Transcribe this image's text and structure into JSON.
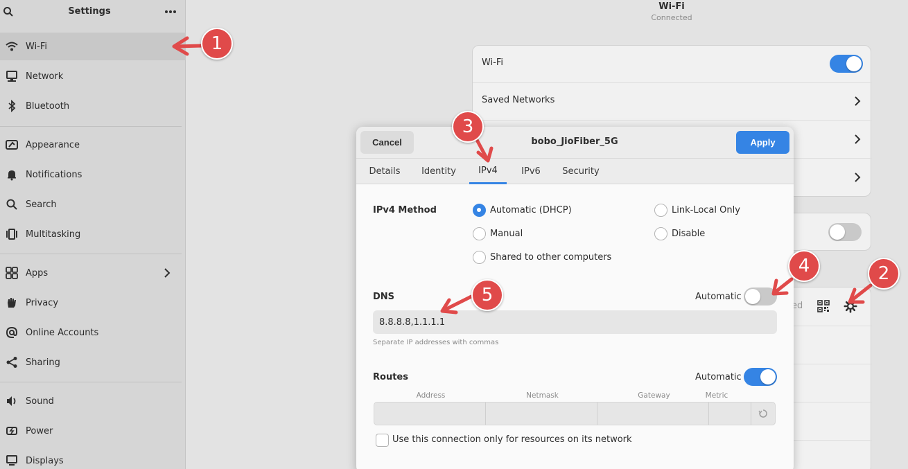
{
  "sidebar": {
    "title": "Settings",
    "items": [
      {
        "label": "Wi-Fi",
        "icon": "wifi-icon"
      },
      {
        "label": "Network",
        "icon": "network-icon"
      },
      {
        "label": "Bluetooth",
        "icon": "bluetooth-icon"
      },
      {
        "label": "Appearance",
        "icon": "appearance-icon"
      },
      {
        "label": "Notifications",
        "icon": "bell-icon"
      },
      {
        "label": "Search",
        "icon": "search-icon"
      },
      {
        "label": "Multitasking",
        "icon": "multitasking-icon"
      },
      {
        "label": "Apps",
        "icon": "apps-icon"
      },
      {
        "label": "Privacy",
        "icon": "hand-icon"
      },
      {
        "label": "Online Accounts",
        "icon": "at-icon"
      },
      {
        "label": "Sharing",
        "icon": "share-icon"
      },
      {
        "label": "Sound",
        "icon": "speaker-icon"
      },
      {
        "label": "Power",
        "icon": "power-icon"
      },
      {
        "label": "Displays",
        "icon": "display-icon"
      }
    ]
  },
  "main": {
    "title": "Wi-Fi",
    "subtitle": "Connected",
    "wifi_label": "Wi-Fi",
    "wifi_enabled": true,
    "saved_networks_label": "Saved Networks",
    "partial_text": "ed"
  },
  "dialog": {
    "cancel_label": "Cancel",
    "title": "bobo_JioFiber_5G",
    "apply_label": "Apply",
    "tabs": [
      "Details",
      "Identity",
      "IPv4",
      "IPv6",
      "Security"
    ],
    "active_tab": "IPv4",
    "ipv4_method_label": "IPv4 Method",
    "methods": {
      "automatic": "Automatic (DHCP)",
      "link_local": "Link-Local Only",
      "manual": "Manual",
      "disable": "Disable",
      "shared": "Shared to other computers"
    },
    "selected_method": "Automatic (DHCP)",
    "dns_label": "DNS",
    "dns_automatic_label": "Automatic",
    "dns_automatic": false,
    "dns_value": "8.8.8.8,1.1.1.1",
    "dns_hint": "Separate IP addresses with commas",
    "routes_label": "Routes",
    "routes_automatic_label": "Automatic",
    "routes_automatic": true,
    "route_columns": [
      "Address",
      "Netmask",
      "Gateway",
      "Metric"
    ],
    "only_resources_label": "Use this connection only for resources on its network"
  },
  "annotations": [
    "1",
    "2",
    "3",
    "4",
    "5"
  ],
  "colors": {
    "accent": "#3584e4",
    "annotation": "#e04a4a"
  }
}
